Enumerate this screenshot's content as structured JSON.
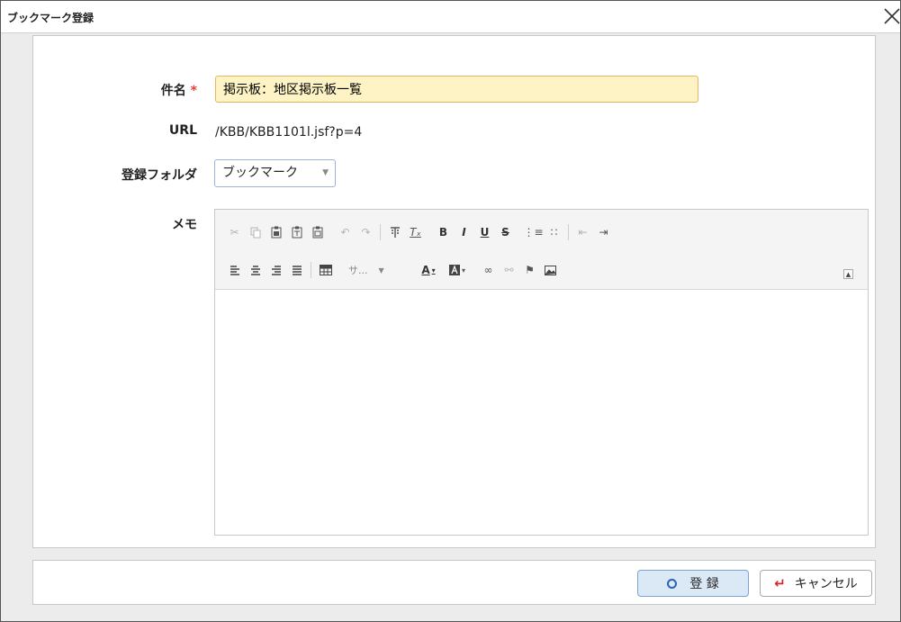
{
  "dialog": {
    "title": "ブックマーク登録"
  },
  "form": {
    "subject_label": "件名",
    "required_mark": "*",
    "subject_value": "掲示板：地区掲示板一覧",
    "url_label": "URL",
    "url_value": "/KBB/KBB1101l.jsf?p=4",
    "folder_label": "登録フォルダ",
    "folder_value": "ブックマーク",
    "memo_label": "メモ"
  },
  "editor": {
    "style_combo": "サ..."
  },
  "footer": {
    "register_label": "登 録",
    "cancel_label": "キャンセル"
  },
  "colors": {
    "subject_bg": "#fdf3c4",
    "required": "#e53b3b",
    "register_bg": "#dbe9f7",
    "cancel_icon": "#d3262b"
  }
}
